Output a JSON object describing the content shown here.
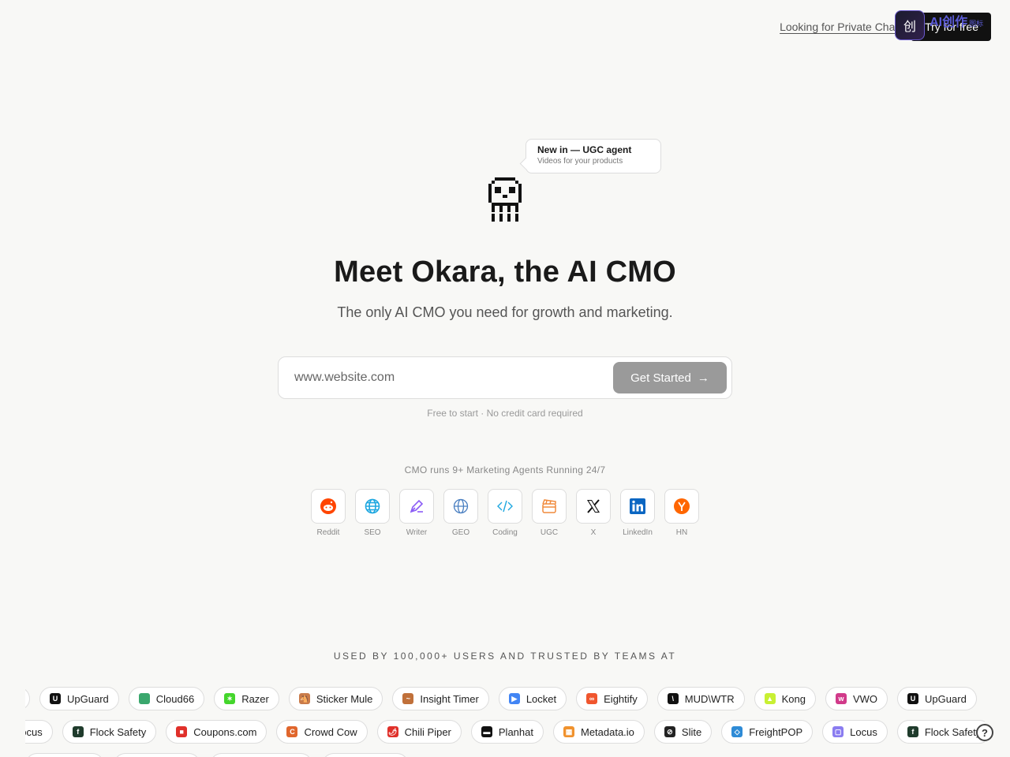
{
  "header": {
    "private_chat_link": "Looking for Private Chat?",
    "try_button": "Try for free",
    "overlay_icon_text": "创",
    "overlay_text": "AI创作",
    "overlay_small": "图标"
  },
  "announcement": {
    "title": "New in — UGC agent",
    "subtitle": "Videos for your products"
  },
  "hero": {
    "headline": "Meet Okara, the AI CMO",
    "subline": "The only AI CMO you need for growth and marketing."
  },
  "signup": {
    "placeholder": "www.website.com",
    "button_label": "Get Started",
    "button_arrow": "→",
    "note": "Free to start · No credit card required"
  },
  "agents": {
    "title": "CMO runs 9+ Marketing Agents Running 24/7",
    "items": [
      {
        "label": "Reddit",
        "icon": "reddit-icon",
        "color": "#ff4500"
      },
      {
        "label": "SEO",
        "icon": "globe-icon",
        "color": "#1ea7e0"
      },
      {
        "label": "Writer",
        "icon": "pen-icon",
        "color": "#8b5cf6"
      },
      {
        "label": "GEO",
        "icon": "globe-outline-icon",
        "color": "#4a7fc1"
      },
      {
        "label": "Coding",
        "icon": "code-icon",
        "color": "#1ea7e0"
      },
      {
        "label": "UGC",
        "icon": "clapper-icon",
        "color": "#f08a3c"
      },
      {
        "label": "X",
        "icon": "x-icon",
        "color": "#111111"
      },
      {
        "label": "LinkedIn",
        "icon": "linkedin-icon",
        "color": "#0a66c2"
      },
      {
        "label": "HN",
        "icon": "hackernews-icon",
        "color": "#ff6600"
      }
    ]
  },
  "social_proof": {
    "title": "USED BY 100,000+ USERS AND TRUSTED BY TEAMS AT",
    "row1": [
      {
        "name": "UpGuard",
        "color": "#111111",
        "glyph": "U"
      },
      {
        "name": "Cloud66",
        "color": "#3aa76d",
        "glyph": ""
      },
      {
        "name": "Razer",
        "color": "#44d62c",
        "glyph": "✶"
      },
      {
        "name": "Sticker Mule",
        "color": "#c97b4a",
        "glyph": "🐴"
      },
      {
        "name": "Insight Timer",
        "color": "#c0703a",
        "glyph": "~"
      },
      {
        "name": "Locket",
        "color": "#4285f4",
        "glyph": "▶"
      },
      {
        "name": "Eightify",
        "color": "#f0562e",
        "glyph": "∞"
      },
      {
        "name": "MUD\\WTR",
        "color": "#111111",
        "glyph": "\\"
      },
      {
        "name": "Kong",
        "color": "#c8f033",
        "glyph": "▲"
      },
      {
        "name": "VWO",
        "color": "#d13a8a",
        "glyph": "w"
      },
      {
        "name": "UpGuard",
        "color": "#111111",
        "glyph": "U"
      }
    ],
    "row2": [
      {
        "name": "Locus",
        "color": "#8a7cf0",
        "glyph": ""
      },
      {
        "name": "Flock Safety",
        "color": "#1f3b2c",
        "glyph": "f"
      },
      {
        "name": "Coupons.com",
        "color": "#e0302a",
        "glyph": "■"
      },
      {
        "name": "Crowd Cow",
        "color": "#e0662c",
        "glyph": "C"
      },
      {
        "name": "Chili Piper",
        "color": "#e0302a",
        "glyph": "🌶"
      },
      {
        "name": "Planhat",
        "color": "#111111",
        "glyph": "▬"
      },
      {
        "name": "Metadata.io",
        "color": "#f0922e",
        "glyph": "▦"
      },
      {
        "name": "Slite",
        "color": "#222222",
        "glyph": "⊘"
      },
      {
        "name": "FreightPOP",
        "color": "#2e8bd6",
        "glyph": "◇"
      },
      {
        "name": "Locus",
        "color": "#8a7cf0",
        "glyph": "▢"
      },
      {
        "name": "Flock Safety",
        "color": "#1f3b2c",
        "glyph": "f"
      }
    ],
    "colors": {
      "page_bg": "#f8f8f6",
      "button_disabled": "#9a9a9a",
      "dark_button": "#111111"
    }
  },
  "help": {
    "glyph": "?"
  }
}
